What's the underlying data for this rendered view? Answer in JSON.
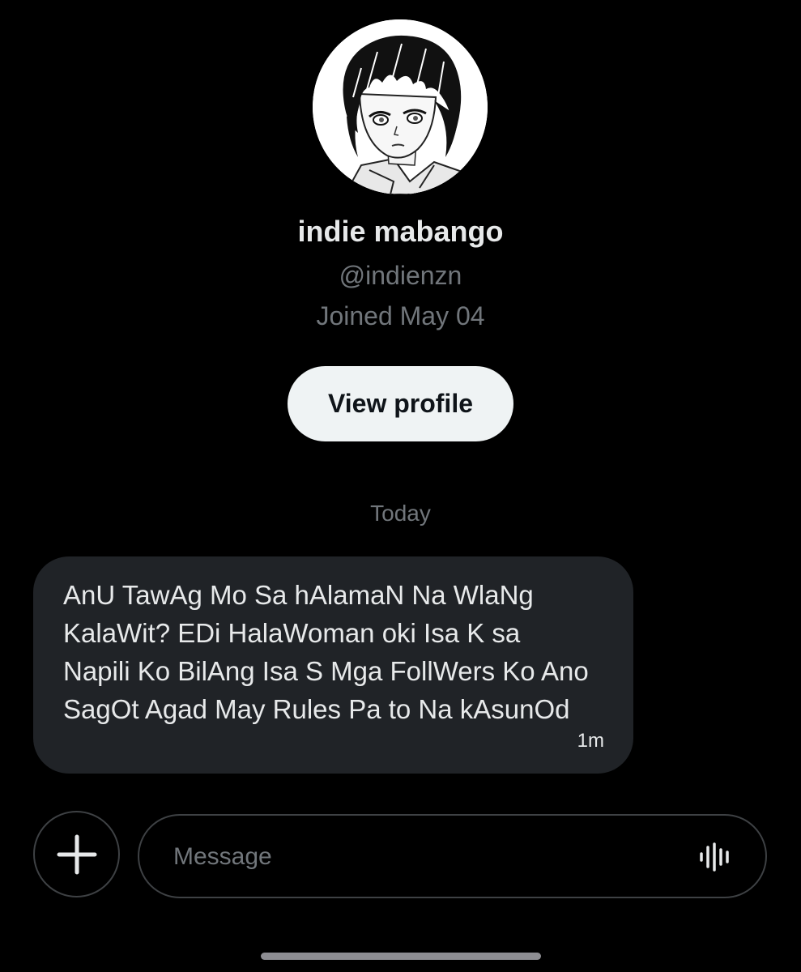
{
  "profile": {
    "display_name": "indie mabango",
    "handle": "@indienzn",
    "joined": "Joined May 04",
    "avatar_icon": "anime-portrait-avatar",
    "view_profile_label": "View profile"
  },
  "conversation": {
    "date_divider": "Today",
    "messages": [
      {
        "lines": [
          "AnU TawAg Mo Sa hAlamaN Na WlaNg",
          "KalaWit? EDi HalaWoman oki Isa K sa",
          "Napili Ko BilAng Isa S Mga FollWers Ko Ano",
          "SagOt Agad May Rules Pa to Na kAsunOd"
        ],
        "time": "1m"
      }
    ]
  },
  "composer": {
    "add_icon": "plus-icon",
    "placeholder": "Message",
    "voice_icon": "voice-waveform-icon"
  },
  "colors": {
    "background": "#000000",
    "bubble": "#202327",
    "primary_text": "#e7e9ea",
    "secondary_text": "#71767b",
    "button_bg": "#eff3f4"
  }
}
